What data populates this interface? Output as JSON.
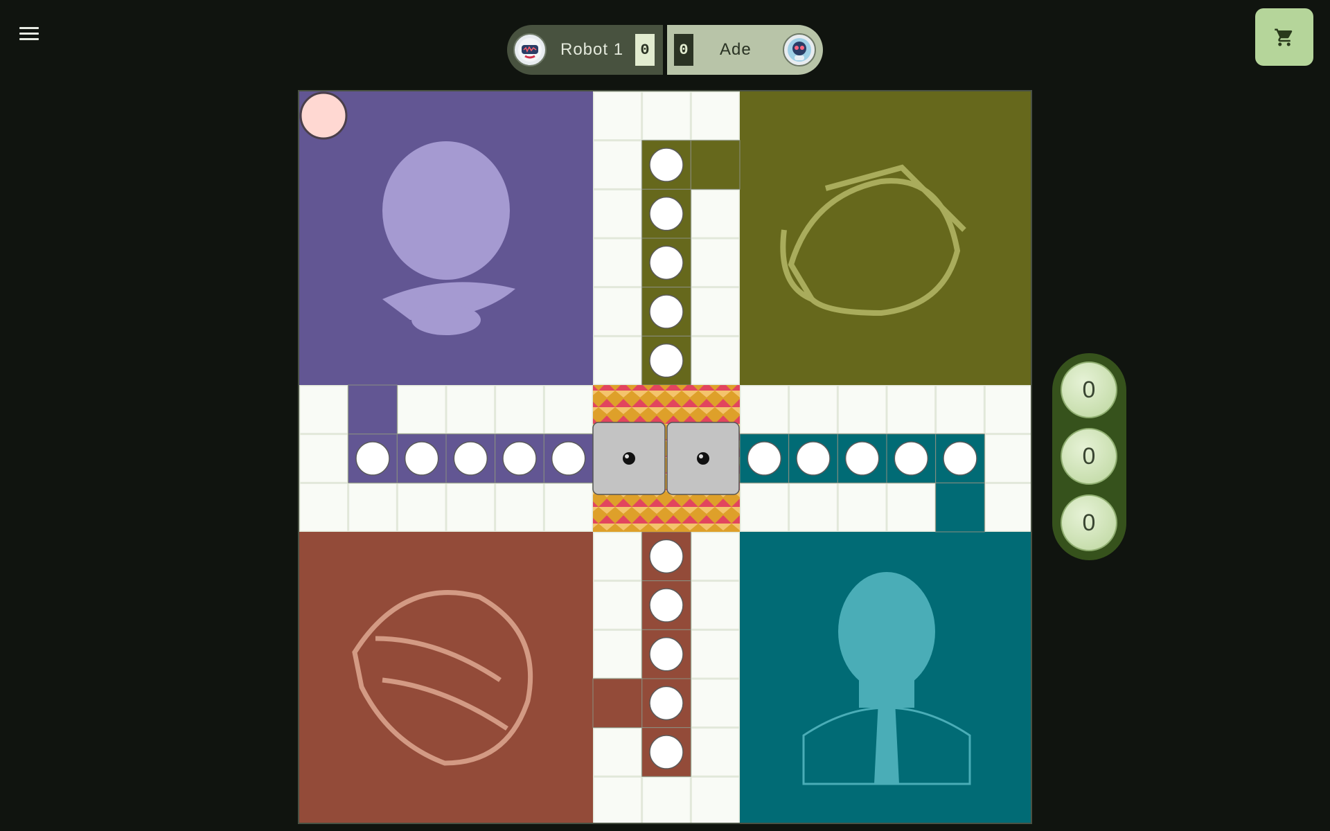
{
  "menu": {
    "icon": "hamburger-menu-icon"
  },
  "cart": {
    "icon": "shopping-cart-icon"
  },
  "players": [
    {
      "name": "Robot 1",
      "score": "0",
      "avatar": "robot-avatar-icon"
    },
    {
      "name": "Ade",
      "score": "0",
      "avatar": "robot-avatar-icon"
    }
  ],
  "roll_buttons": [
    "0",
    "0",
    "0"
  ],
  "dice": [
    1,
    1
  ],
  "board": {
    "colors": {
      "purple": "#625693",
      "olive": "#66681c",
      "teal": "#016b75",
      "brown": "#934b39",
      "path": "#f9fbf6",
      "grid": "#e2e8da"
    },
    "tokens": [
      {
        "color": "#ffd8d2",
        "location": "purple-base"
      }
    ]
  }
}
